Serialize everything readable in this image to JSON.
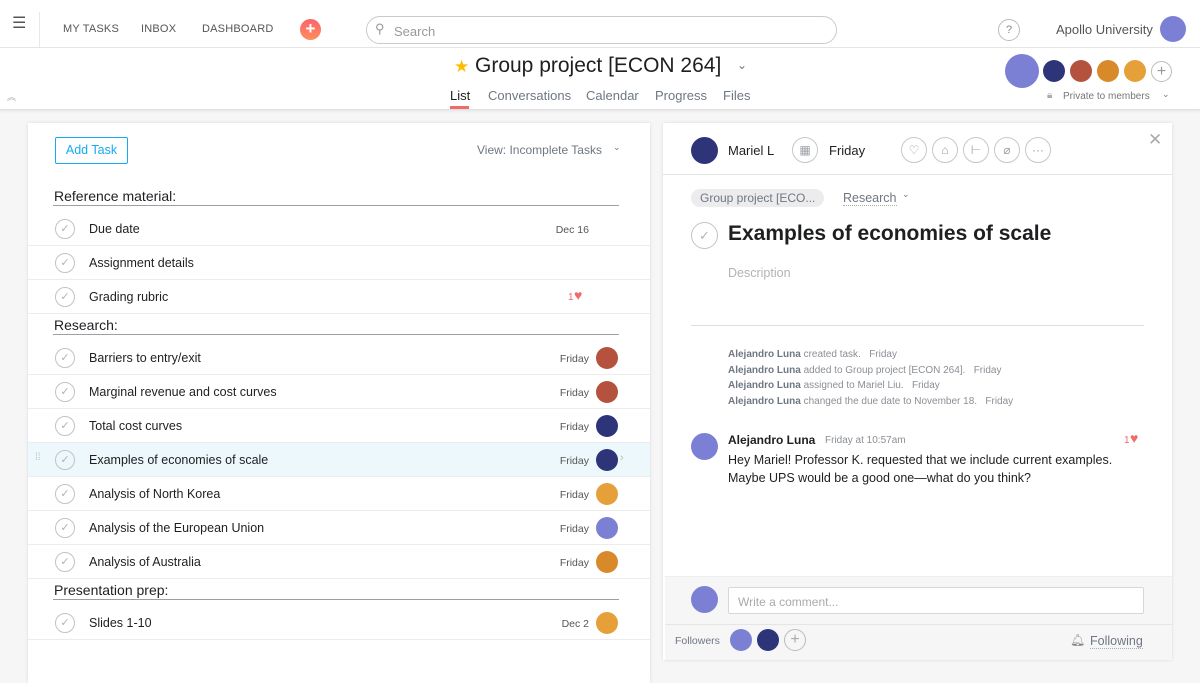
{
  "topbar": {
    "nav": [
      "MY TASKS",
      "INBOX",
      "DASHBOARD"
    ],
    "search_placeholder": "Search",
    "help": "?",
    "org": "Apollo University"
  },
  "project": {
    "title": "Group project [ECON 264]",
    "tabs": [
      "List",
      "Conversations",
      "Calendar",
      "Progress",
      "Files"
    ],
    "active_tab": "List",
    "privacy": "Private to members"
  },
  "list": {
    "add_task": "Add Task",
    "view": "View: Incomplete Tasks",
    "sections": [
      {
        "title": "Reference material:",
        "tasks": [
          {
            "name": "Due date",
            "date": "Dec 16"
          },
          {
            "name": "Assignment details",
            "date": ""
          },
          {
            "name": "Grading rubric",
            "date": "",
            "likes": "1"
          }
        ]
      },
      {
        "title": "Research:",
        "tasks": [
          {
            "name": "Barriers to entry/exit",
            "date": "Friday",
            "avatar": "#b4523e"
          },
          {
            "name": "Marginal revenue and cost curves",
            "date": "Friday",
            "avatar": "#b4523e"
          },
          {
            "name": "Total cost curves",
            "date": "Friday",
            "avatar": "#2d3478"
          },
          {
            "name": "Examples of economies of scale",
            "date": "Friday",
            "avatar": "#2d3478",
            "selected": true
          },
          {
            "name": "Analysis of North Korea",
            "date": "Friday",
            "avatar": "#e5a03a"
          },
          {
            "name": "Analysis of the European Union",
            "date": "Friday",
            "avatar": "#7b80d4"
          },
          {
            "name": "Analysis of Australia",
            "date": "Friday",
            "avatar": "#d88a2a"
          }
        ]
      },
      {
        "title": "Presentation prep:",
        "tasks": [
          {
            "name": "Slides 1-10",
            "date": "Dec 2",
            "avatar": "#e5a03a"
          }
        ]
      }
    ]
  },
  "detail": {
    "assignee": "Mariel L",
    "due": "Friday",
    "project_tag": "Group project [ECO...",
    "section": "Research",
    "title": "Examples of economies of scale",
    "description_placeholder": "Description",
    "activity": [
      {
        "who": "Alejandro Luna",
        "what": "created task.",
        "when": "Friday"
      },
      {
        "who": "Alejandro Luna",
        "what": "added to Group project [ECON 264].",
        "when": "Friday"
      },
      {
        "who": "Alejandro Luna",
        "what": "assigned to Mariel Liu.",
        "when": "Friday"
      },
      {
        "who": "Alejandro Luna",
        "what": "changed the due date to November 18.",
        "when": "Friday"
      }
    ],
    "comment": {
      "author": "Alejandro Luna",
      "time": "Friday at 10:57am",
      "likes": "1",
      "line1": "Hey Mariel! Professor K. requested that we include current examples.",
      "line2": "Maybe UPS would be a good one—what do you think?"
    },
    "comment_placeholder": "Write a comment...",
    "followers_label": "Followers",
    "following": "Following"
  },
  "colors": {
    "accent": "#f06a6a",
    "star": "#fcbd01",
    "selected_row": "#edf8fc",
    "add_task": "#14aaf5"
  }
}
